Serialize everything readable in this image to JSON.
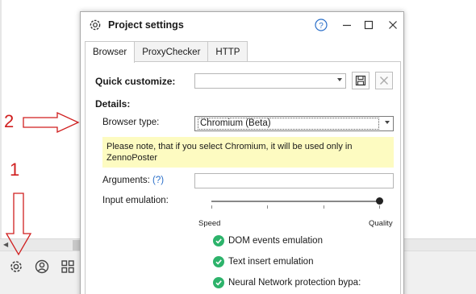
{
  "dialog": {
    "title": "Project settings",
    "tabs": [
      {
        "label": "Browser",
        "active": true
      },
      {
        "label": "ProxyChecker",
        "active": false
      },
      {
        "label": "HTTP",
        "active": false
      }
    ]
  },
  "form": {
    "quick_customize_label": "Quick customize:",
    "quick_customize_value": "",
    "details_label": "Details:",
    "browser_type_label": "Browser type:",
    "browser_type_value": "Chromium (Beta)",
    "note": "Please note, that if you select Chromium, it will be used only in ZennoPoster",
    "arguments_label": "Arguments:",
    "arguments_help": "(?)",
    "arguments_value": "",
    "input_emulation_label": "Input emulation:",
    "input_emulation_level": 1.0,
    "scale_min_label": "Speed",
    "scale_max_label": "Quality",
    "options": [
      {
        "label": "DOM events emulation",
        "checked": true
      },
      {
        "label": "Text insert emulation",
        "checked": true
      },
      {
        "label": "Neural Network protection bypa:",
        "checked": true
      }
    ]
  },
  "annotations": {
    "label_1": "1",
    "label_2": "2",
    "color": "#d01f1f"
  },
  "colors": {
    "note_bg": "#fdfbc1",
    "check_green": "#2db36b",
    "link_blue": "#2a6fc9"
  }
}
